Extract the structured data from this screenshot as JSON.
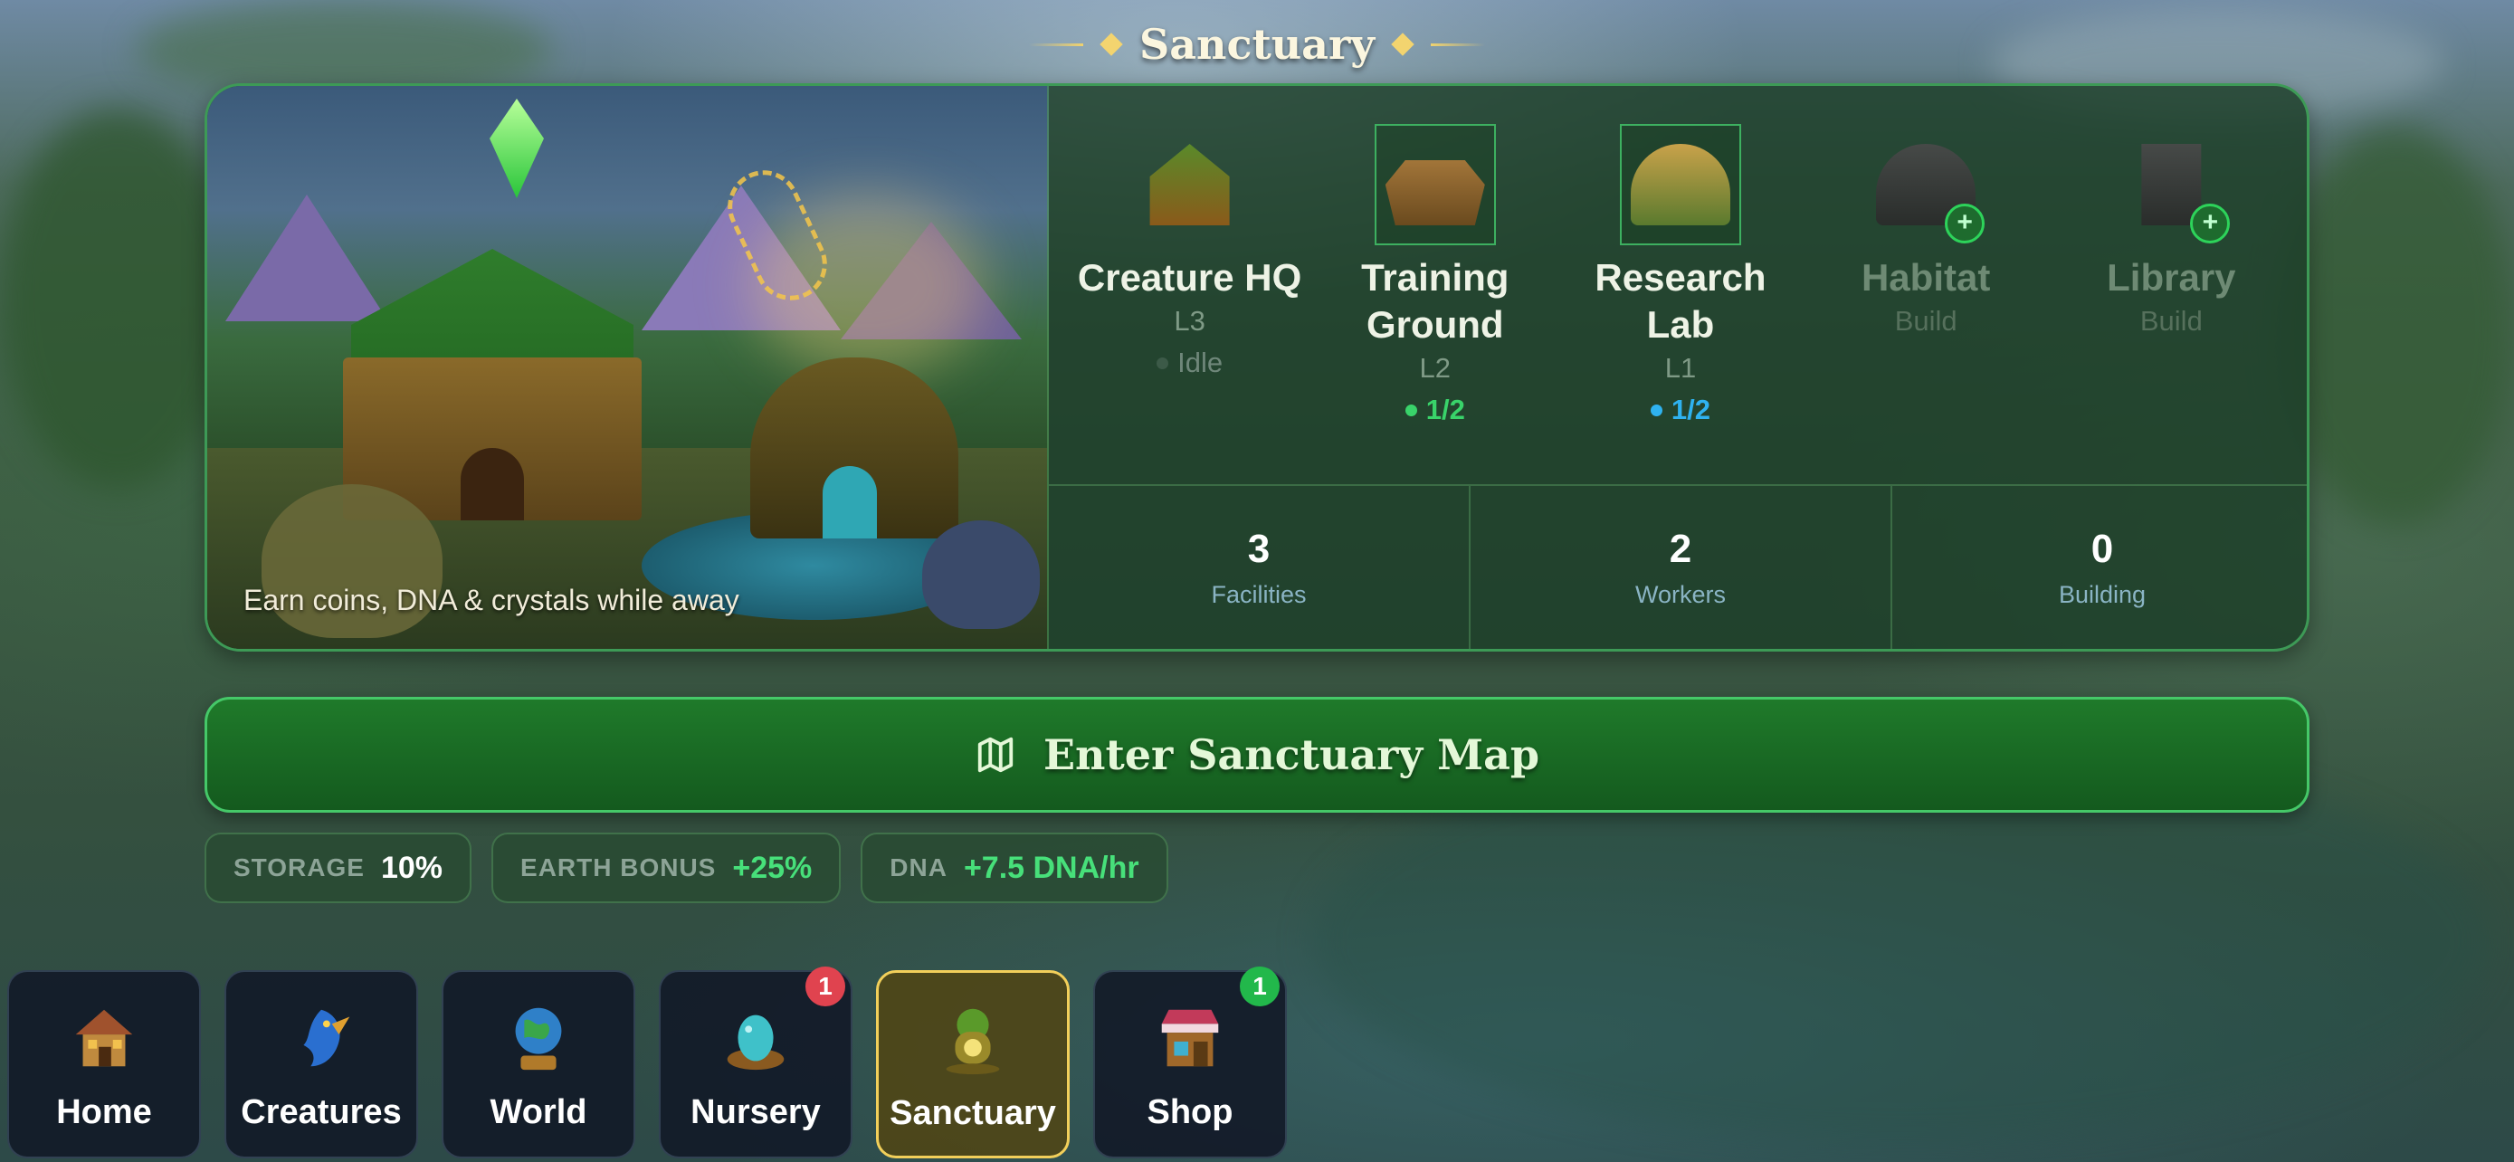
{
  "header": {
    "title": "Sanctuary"
  },
  "scene": {
    "caption": "Earn coins, DNA & crystals while away"
  },
  "facilities": [
    {
      "name": "Creature HQ",
      "level": "L3",
      "status": "Idle",
      "status_kind": "idle",
      "icon": "creature-hq-icon",
      "built": true,
      "selected": false
    },
    {
      "name": "Training Ground",
      "level": "L2",
      "status": "1/2",
      "status_kind": "green",
      "icon": "training-ground-icon",
      "built": true,
      "selected": true
    },
    {
      "name": "Research Lab",
      "level": "L1",
      "status": "1/2",
      "status_kind": "blue",
      "icon": "research-lab-icon",
      "built": true,
      "selected": true
    },
    {
      "name": "Habitat",
      "level": "Build",
      "status": "",
      "status_kind": "none",
      "icon": "habitat-icon",
      "built": false,
      "selected": false
    },
    {
      "name": "Library",
      "level": "Build",
      "status": "",
      "status_kind": "none",
      "icon": "library-icon",
      "built": false,
      "selected": false
    }
  ],
  "stats": [
    {
      "value": "3",
      "label": "Facilities"
    },
    {
      "value": "2",
      "label": "Workers"
    },
    {
      "value": "0",
      "label": "Building"
    }
  ],
  "enter_button": {
    "label": "Enter Sanctuary Map",
    "icon": "map-icon"
  },
  "chips": [
    {
      "key": "STORAGE",
      "value": "10%",
      "value_color": "#ffffff"
    },
    {
      "key": "EARTH BONUS",
      "value": "+25%",
      "value_color": "#47e07a"
    },
    {
      "key": "DNA",
      "value": "+7.5 DNA/hr",
      "value_color": "#47e07a"
    }
  ],
  "tabs": [
    {
      "label": "Home",
      "icon": "home-icon",
      "active": false,
      "badge": ""
    },
    {
      "label": "Creatures",
      "icon": "dragon-icon",
      "active": false,
      "badge": ""
    },
    {
      "label": "World",
      "icon": "globe-icon",
      "active": false,
      "badge": ""
    },
    {
      "label": "Nursery",
      "icon": "egg-icon",
      "active": false,
      "badge": "1",
      "badge_color": "red"
    },
    {
      "label": "Sanctuary",
      "icon": "sanctuary-icon",
      "active": true,
      "badge": ""
    },
    {
      "label": "Shop",
      "icon": "shop-icon",
      "active": false,
      "badge": "1",
      "badge_color": "green"
    }
  ],
  "colors": {
    "accent_green": "#3d9a56",
    "active_tab_border": "#f2cf5a",
    "status_blue": "#2fb2f0",
    "status_green": "#39d36a"
  }
}
